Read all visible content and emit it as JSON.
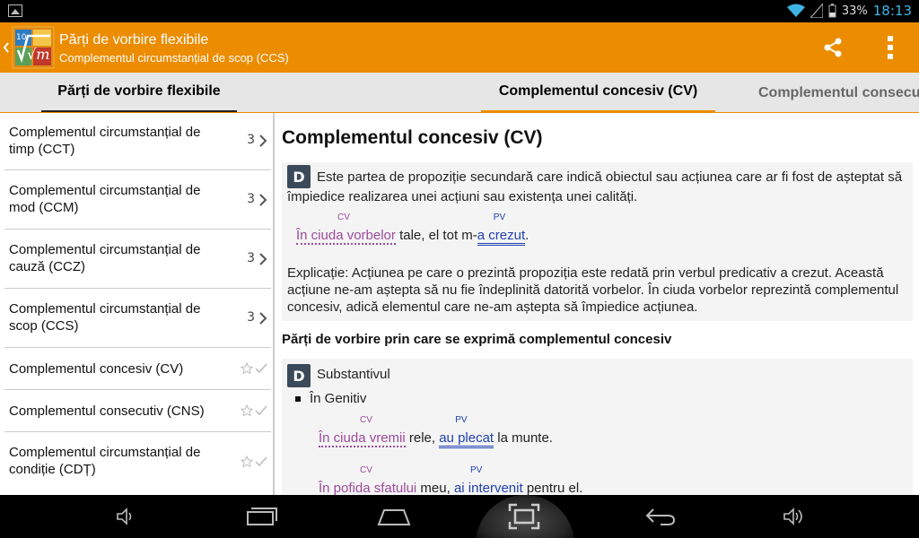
{
  "status_bar": {
    "battery_percent": "33%",
    "time": "18:13",
    "icons": [
      "gallery-icon",
      "wifi-icon",
      "signal-icon",
      "battery-icon"
    ]
  },
  "action_bar": {
    "logo_text": "√m",
    "logo_superscript": "10",
    "title": "Părți de vorbire flexibile",
    "subtitle": "Complementul circumstanțial de scop (CCS)",
    "icons": [
      "share-icon",
      "overflow-menu-icon"
    ]
  },
  "tabs": {
    "left": "Părți de vorbire flexibile",
    "active": "Complementul concesiv (CV)",
    "next": "Complementul consecutiv (CNS)"
  },
  "sidebar": {
    "items": [
      {
        "label": "Complementul circumstanțial de timp (CCT)",
        "count": "3",
        "type": "group"
      },
      {
        "label": "Complementul circumstanțial de mod (CCM)",
        "count": "3",
        "type": "group"
      },
      {
        "label": "Complementul circumstanțial de cauză (CCZ)",
        "count": "3",
        "type": "group"
      },
      {
        "label": "Complementul circumstanțial de scop (CCS)",
        "count": "3",
        "type": "group"
      },
      {
        "label": "Complementul concesiv (CV)",
        "type": "leaf"
      },
      {
        "label": "Complementul consecutiv (CNS)",
        "type": "leaf"
      },
      {
        "label": "Complementul circumstanțial de condiție (CDȚ)",
        "type": "leaf"
      }
    ]
  },
  "content": {
    "title": "Complementul concesiv (CV)",
    "badge": "D",
    "definition": "Este partea de propoziție secundară care indică obiectul sau acțiunea care ar fi fost de așteptat să împiedice realizarea unei acțiuni sau existența unei calități.",
    "example1": {
      "cv_text": "În ciuda vorbelor",
      "middle": " tale, el tot m-",
      "pv_text": "a crezut",
      "end": ".",
      "cv_tag": "CV",
      "pv_tag": "PV"
    },
    "explanation": "Explicație: Acțiunea pe care o prezintă propoziția este redată prin verbul predicativ a crezut. Această acțiune ne-am aștepta să nu fie îndeplinită datorită vorbelor. În ciuda vorbelor reprezintă complementul concesiv, adică elementul care ne-am aștepta să împiedice acțiunea.",
    "section_title": "Părți de vorbire prin care se exprimă complementul concesiv",
    "sub": {
      "badge": "D",
      "title": "Substantivul",
      "bullet": "În Genitiv",
      "example2": {
        "cv_text": "În ciuda vremii",
        "middle": " rele, ",
        "pv_text": "au plecat",
        "end": " la munte.",
        "cv_tag": "CV",
        "pv_tag": "PV"
      },
      "example3": {
        "cv_text": "În pofida sfatului",
        "middle": " meu, ",
        "pv_text": "ai intervenit",
        "end": " pentru el.",
        "cv_tag": "CV",
        "pv_tag": "PV"
      }
    }
  },
  "nav_bar": {
    "icons": [
      "volume-down-icon",
      "recent-apps-icon",
      "home-icon",
      "screenshot-icon",
      "back-icon",
      "volume-up-icon"
    ]
  }
}
